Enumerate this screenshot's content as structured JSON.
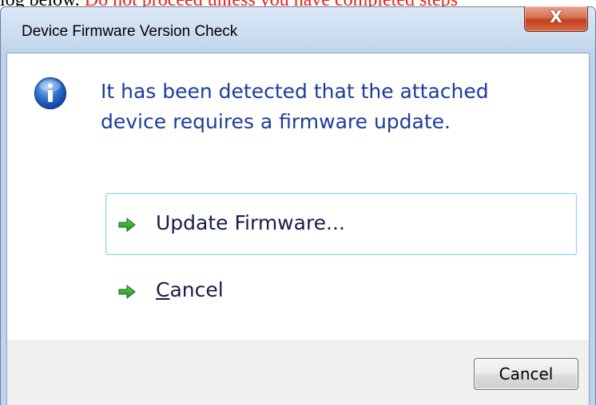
{
  "background": {
    "text_plain": "log below. ",
    "text_warning": "Do not proceed unless you have completed steps",
    "warning_color": "#e8211d"
  },
  "window": {
    "title": "Device Firmware Version Check",
    "close_label": "X"
  },
  "dialog": {
    "icon": "info-icon",
    "message_line1": "It has been detected that the attached",
    "message_line2": "device requires a firmware update.",
    "message_color": "#1e3d9a"
  },
  "commands": {
    "update_label": "Update Firmware...",
    "cancel_accel": "C",
    "cancel_rest": "ancel",
    "arrow_icon": "green-arrow-icon"
  },
  "footer": {
    "cancel_button_label": "Cancel"
  }
}
